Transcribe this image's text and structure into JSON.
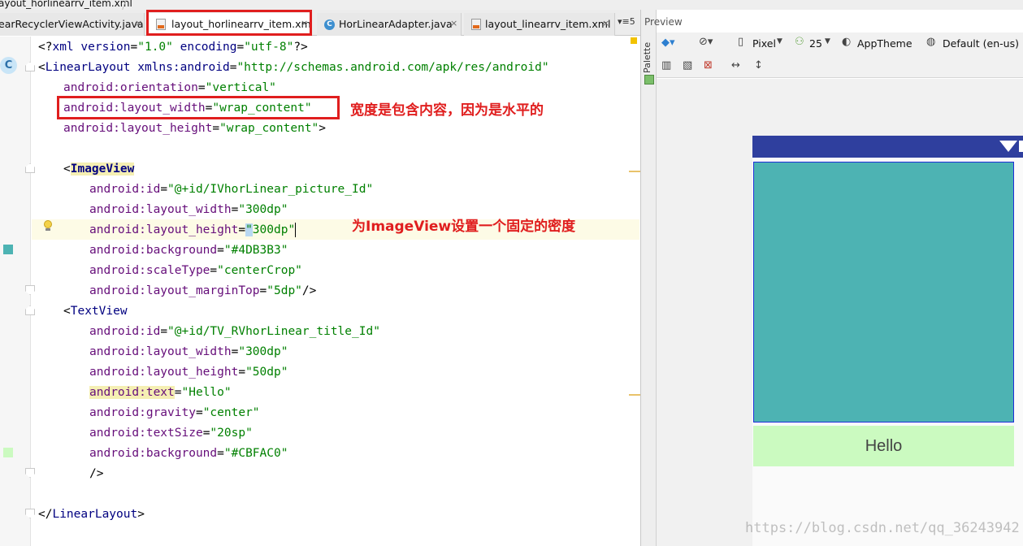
{
  "breadcrumb": {
    "file": "ayout_horlinearrv_item.xml"
  },
  "tabs": [
    {
      "label": "earRecyclerViewActivity.java",
      "kind": "java"
    },
    {
      "label": "layout_horlinearrv_item.xml",
      "kind": "xml",
      "active": true
    },
    {
      "label": "HorLinearAdapter.java",
      "kind": "java"
    },
    {
      "label": "layout_linearrv_item.xml",
      "kind": "xml"
    }
  ],
  "tab_overflow": "▾≡5",
  "tab_close": "×",
  "gutter": {
    "class_badge": "C"
  },
  "code": {
    "l1": {
      "a": "<?",
      "b": "xml version",
      "c": "=",
      "d": "\"1.0\"",
      "e": " encoding",
      "f": "=",
      "g": "\"utf-8\"",
      "h": "?>"
    },
    "l2": {
      "a": "<",
      "b": "LinearLayout",
      "c": " xmlns:android",
      "d": "=",
      "e": "\"http://schemas.android.com/apk/res/android\""
    },
    "l3": {
      "a": "android:orientation",
      "b": "=",
      "c": "\"vertical\""
    },
    "l4": {
      "a": "android:layout_width",
      "b": "=",
      "c": "\"wrap_content\""
    },
    "l5": {
      "a": "android:layout_height",
      "b": "=",
      "c": "\"wrap_content\"",
      "d": ">"
    },
    "l6": {
      "a": "<",
      "b": "ImageView"
    },
    "l7": {
      "a": "android:id",
      "b": "=",
      "c": "\"@+id/IVhorLinear_picture_Id\""
    },
    "l8": {
      "a": "android:layout_width",
      "b": "=",
      "c": "\"300dp\""
    },
    "l9": {
      "a": "android:layout_height",
      "b": "=",
      "c": "\"",
      "d": "300dp",
      "e": "\""
    },
    "l10": {
      "a": "android:background",
      "b": "=",
      "c": "\"#4DB3B3\""
    },
    "l11": {
      "a": "android:scaleType",
      "b": "=",
      "c": "\"centerCrop\""
    },
    "l12": {
      "a": "android:layout_marginTop",
      "b": "=",
      "c": "\"5dp\"",
      "d": "/>"
    },
    "l13": {
      "a": "<",
      "b": "TextView"
    },
    "l14": {
      "a": "android:id",
      "b": "=",
      "c": "\"@+id/TV_RVhorLinear_title_Id\""
    },
    "l15": {
      "a": "android:layout_width",
      "b": "=",
      "c": "\"300dp\""
    },
    "l16": {
      "a": "android:layout_height",
      "b": "=",
      "c": "\"50dp\""
    },
    "l17": {
      "a": "android:text",
      "b": "=",
      "c": "\"Hello\""
    },
    "l18": {
      "a": "android:gravity",
      "b": "=",
      "c": "\"center\""
    },
    "l19": {
      "a": "android:textSize",
      "b": "=",
      "c": "\"20sp\""
    },
    "l20": {
      "a": "android:background",
      "b": "=",
      "c": "\"#CBFAC0\""
    },
    "l21": {
      "a": "/>"
    },
    "l22": {
      "a": "</",
      "b": "LinearLayout",
      "c": ">"
    }
  },
  "annotations": {
    "width_note": "宽度是包含内容，因为是水平的",
    "imageview_note": "为ImageView设置一个固定的密度"
  },
  "preview": {
    "title": "Preview",
    "palette_label": "Palette",
    "device": "Pixel",
    "api_level": "25",
    "theme": "AppTheme",
    "locale": "Default (en-us)",
    "text_view_text": "Hello"
  },
  "watermark": "https://blog.csdn.net/qq_36243942",
  "colors": {
    "image_view_background": "#4DB3B3",
    "text_view_background": "#CBFAC0",
    "status_bar": "#2F3F9E",
    "annotation_red": "#E01E1E"
  }
}
